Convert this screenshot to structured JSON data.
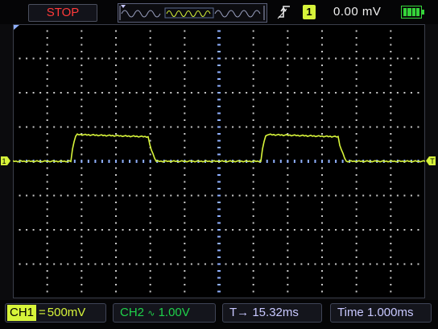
{
  "status": {
    "run_state": "STOP"
  },
  "trigger": {
    "edge_icon": "rising-edge-icon",
    "channel": "1",
    "level": "0.00 mV"
  },
  "battery": {
    "icon": "battery-icon",
    "level": 1.0
  },
  "channel_markers": {
    "ch1": "1",
    "trigger": "T"
  },
  "bottom": {
    "ch1_label": "CH1",
    "ch1_coupling": "=",
    "ch1_scale": "500mV",
    "ch2_label": "CH2",
    "ch2_coupling": "∿",
    "ch2_scale": "1.00V",
    "trigger_pos_label": "T→",
    "trigger_pos": "15.32ms",
    "time_label": "Time",
    "time_base": "1.000ms"
  },
  "colors": {
    "ch1": "#d7f43a",
    "ch2": "#1fd14a",
    "stop": "#ff3a3a",
    "grid": "#c8c8c8",
    "center_axis": "#8fb0ff"
  }
}
